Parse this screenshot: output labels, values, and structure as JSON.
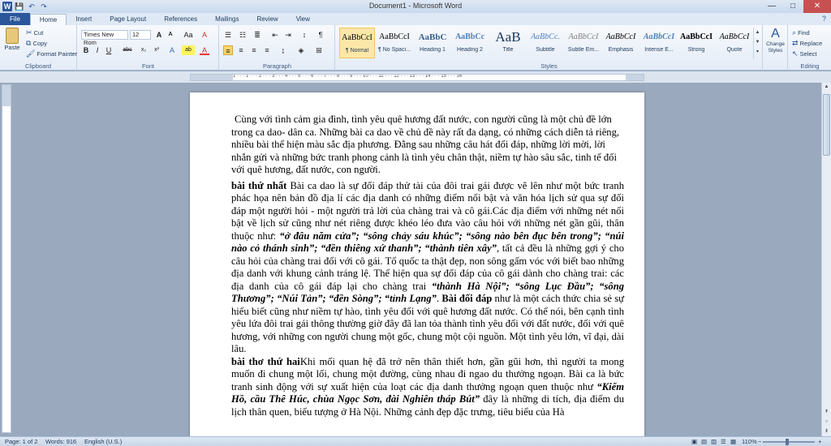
{
  "window": {
    "title": "Document1 - Microsoft Word",
    "controls": {
      "minimize": "—",
      "maximize": "□",
      "close": "✕"
    }
  },
  "qat": {
    "word_logo": "W",
    "save": "💾",
    "undo": "↶",
    "redo": "↷"
  },
  "tabs": [
    "File",
    "Home",
    "Insert",
    "Page Layout",
    "References",
    "Mailings",
    "Review",
    "View"
  ],
  "ribbon": {
    "clipboard": {
      "paste": "Paste",
      "cut": "Cut",
      "copy": "Copy",
      "format_painter": "Format Painter",
      "label": "Clipboard"
    },
    "font": {
      "family": "Times New Rom",
      "size": "12",
      "label": "Font",
      "bold": "B",
      "italic": "I",
      "underline": "U",
      "grow": "A",
      "shrink": "A",
      "case": "Aa",
      "clear": "A",
      "strike": "abc",
      "sub": "x₂",
      "sup": "x²",
      "color": "A",
      "highlight": "ab"
    },
    "paragraph": {
      "label": "Paragraph"
    },
    "styles": {
      "label": "Styles",
      "items": [
        {
          "sample": "AaBbCcI",
          "name": "¶ Normal"
        },
        {
          "sample": "AaBbCcI",
          "name": "¶ No Spaci..."
        },
        {
          "sample": "AaBbC",
          "name": "Heading 1"
        },
        {
          "sample": "AaBbCc",
          "name": "Heading 2"
        },
        {
          "sample": "AaB",
          "name": "Title"
        },
        {
          "sample": "AaBbCc.",
          "name": "Subtitle"
        },
        {
          "sample": "AaBbCcI",
          "name": "Subtle Em..."
        },
        {
          "sample": "AaBbCcI",
          "name": "Emphasis"
        },
        {
          "sample": "AaBbCcI",
          "name": "Intense E..."
        },
        {
          "sample": "AaBbCcI",
          "name": "Strong"
        },
        {
          "sample": "AaBbCcI",
          "name": "Quote"
        }
      ],
      "change_styles": "Change Styles"
    },
    "editing": {
      "find": "Find",
      "replace": "Replace",
      "select": "Select",
      "label": "Editing"
    }
  },
  "ruler": {
    "numbers": "1 · · · 1 · · · 2 · · · 3 · · · 4 · · · 5 · · · 6 · · · 7 · · · 8 · · · 9 · · · 10 · · · 11 · · · 12 · · · 13 · · · 14 · · · 15 · · · 16"
  },
  "document": {
    "p1": "Cùng với tình cảm gia đình, tình yêu quê hương đất nước, con người cũng là một chủ đề lớn trong ca dao- dân ca. Những bài ca dao về chủ đề này rất đa dạng, có những cách diễn tả riêng, nhiều bài thể hiện màu sắc địa phương. Đằng sau những câu hát đối đáp, những lời mời, lời nhắn gửi và những bức tranh phong cảnh là tình yêu chân thật, niềm tự hào sâu sắc, tinh tế đối với quê hương, đất nước, con người.",
    "p2_lead": "bài thứ nhất",
    "p2_a": " Bài ca dao là sự đối đáp thử tài của đôi trai gái được vẽ lên như một bức tranh phác họa nên bản đồ địa lí các địa danh có những điểm nổi bật và văn hóa lịch sử qua sự đối đáp một người hỏi - một người trả lời của chàng trai và cô gái.Các địa điểm với những nét nổi bật về lịch sử cũng như nét riêng được khéo léo đưa vào câu hỏi với những nét gần gũi, thân thuộc như: ",
    "p2_q": "“ở đâu năm cửa”; “sông chảy sáu khúc”; “sông nào bên đục bên trong”; “núi nào cỏ thánh sinh”; “đền thiêng xứ thanh”; “thành tiên xây”",
    "p2_b": ", tất cả đều là những gợi ý cho câu hỏi của chàng trai đối với cô gái. Tổ quốc ta thật đẹp, non sông gấm vóc với biết bao những địa danh với khung cảnh tráng lệ. Thể hiện qua sự đối đáp của cô gái dành cho chàng trai: các địa danh của cô gái đáp lại cho chàng trai ",
    "p2_ans": "“thành Hà Nội”; “sông Lục Đầu”; “sông Thương”; “Núi Tản”; “đền Sòng”; “tỉnh Lạng”",
    "p2_dot": ". ",
    "p2_bold": "Bài đối đáp",
    "p2_c": " như là một cách thức chia sẻ sự hiểu biết cũng như niềm tự hào, tình yêu đối với quê hương đất nước. Có thể nói, bên cạnh tình yêu lứa đôi trai gái thông thường giờ đây đã lan tỏa thành tình yêu đối với đất nước, đối với quê hương, với những con người chung một gốc, chung một cội nguồn. Một tình yêu lớn, vĩ đại, dài lâu.",
    "p3_lead": "bài thơ thứ hai",
    "p3_a": "Khi mối quan hệ đã trở nên thân thiết hơn, gần gũi hơn, thì người ta mong muốn đi chung một lối, chung một đường, cùng nhau đi ngao du thưởng ngoạn. Bài ca là bức tranh sinh động với sự xuất hiện của loạt các địa danh thưởng ngoạn quen thuộc như ",
    "p3_q": "“Kiếm Hồ, cầu Thê Húc, chùa Ngọc Sơn, đài Nghiên tháp Bút”",
    "p3_b": " đây là những di tích, địa điểm du lịch thân quen, biểu tượng ở Hà Nội. Những cảnh đẹp đặc trưng, tiêu biểu của Hà"
  },
  "status": {
    "page": "Page: 1 of 2",
    "words": "Words: 916",
    "lang": "English (U.S.)",
    "zoom": "110%"
  }
}
